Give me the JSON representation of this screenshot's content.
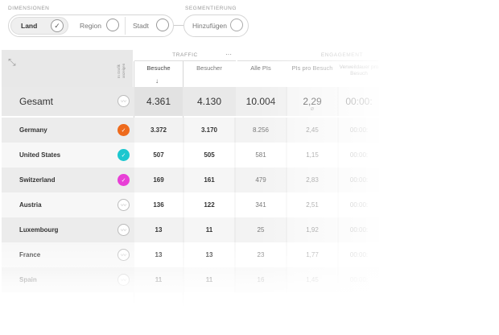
{
  "filters": {
    "dimensions_label": "DIMENSIONEN",
    "segment_label": "SEGMENTIERUNG",
    "dimensions": [
      {
        "label": "Land",
        "active": true,
        "icon": "check-icon"
      },
      {
        "label": "Region",
        "active": false
      },
      {
        "label": "Stadt",
        "active": false
      }
    ],
    "segment_add": "Hinzufügen"
  },
  "table": {
    "trend_header": "In Grafik anzeigen",
    "groups": [
      {
        "label": "TRAFFIC"
      },
      {
        "label": "ENGAGEMENT"
      }
    ],
    "group_menu": "···",
    "columns": [
      "Besuche",
      "Besucher",
      "Alle PIs",
      "PIs pro Besuch",
      "Verweildauer pro Besuch"
    ],
    "sort_arrow": "↓",
    "total": {
      "label": "Gesamt",
      "values": [
        "4.361",
        "4.130",
        "10.004",
        "2,29",
        "00:00:"
      ],
      "sub_note": "Ø"
    },
    "rows": [
      {
        "label": "Germany",
        "values": [
          "3.372",
          "3.170",
          "8.256",
          "2,45",
          "00:00:"
        ],
        "color": "#ee6a1c"
      },
      {
        "label": "United States",
        "values": [
          "507",
          "505",
          "581",
          "1,15",
          "00:00:"
        ],
        "color": "#1cc7cf"
      },
      {
        "label": "Switzerland",
        "values": [
          "169",
          "161",
          "479",
          "2,83",
          "00:00:"
        ],
        "color": "#e83fd6"
      },
      {
        "label": "Austria",
        "values": [
          "136",
          "122",
          "341",
          "2,51",
          "00:00:"
        ],
        "color": null
      },
      {
        "label": "Luxembourg",
        "values": [
          "13",
          "11",
          "25",
          "1,92",
          "00:00:"
        ],
        "color": null
      },
      {
        "label": "France",
        "values": [
          "13",
          "13",
          "23",
          "1,77",
          "00:00:"
        ],
        "color": null
      },
      {
        "label": "Spain",
        "values": [
          "11",
          "11",
          "16",
          "1,45",
          "00:00:"
        ],
        "color": null
      }
    ],
    "trend_icon": "trend-line-icon",
    "expand_icon": "expand-icon"
  }
}
